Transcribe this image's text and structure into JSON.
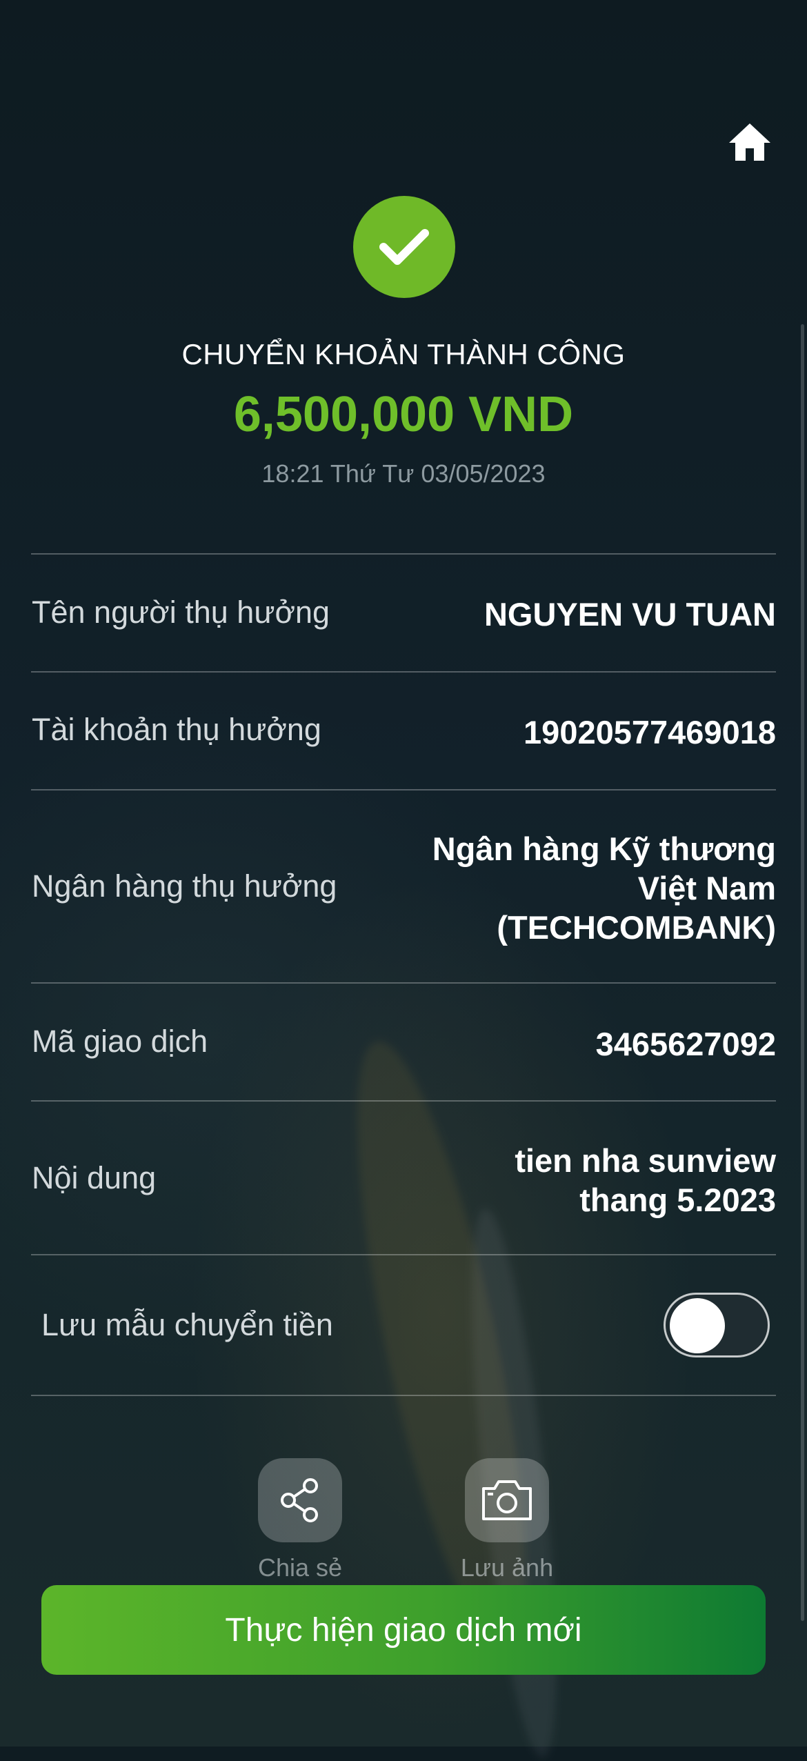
{
  "header": {
    "home_icon": "home-icon"
  },
  "status": {
    "icon": "check-icon",
    "title": "CHUYỂN KHOẢN THÀNH CÔNG",
    "amount": "6,500,000 VND",
    "timestamp": "18:21 Thứ Tư 03/05/2023",
    "accent_color": "#6fbf2a"
  },
  "details": [
    {
      "label": "Tên người thụ hưởng",
      "value": "NGUYEN VU TUAN"
    },
    {
      "label": "Tài khoản thụ hưởng",
      "value": "19020577469018"
    },
    {
      "label": "Ngân hàng thụ hưởng",
      "value_lines": [
        "Ngân hàng Kỹ thương",
        "Việt Nam",
        "(TECHCOMBANK)"
      ]
    },
    {
      "label": "Mã giao dịch",
      "value": "3465627092"
    },
    {
      "label": "Nội dung",
      "value_lines": [
        "tien nha sunview",
        "thang 5.2023"
      ]
    }
  ],
  "save_template": {
    "label": "Lưu mẫu chuyển tiền",
    "enabled": false
  },
  "actions": [
    {
      "icon": "share-icon",
      "label": "Chia sẻ"
    },
    {
      "icon": "camera-icon",
      "label": "Lưu ảnh"
    }
  ],
  "primary_button": {
    "label": "Thực hiện giao dịch mới",
    "gradient_start": "#5cb52a",
    "gradient_end": "#0e7a32"
  }
}
